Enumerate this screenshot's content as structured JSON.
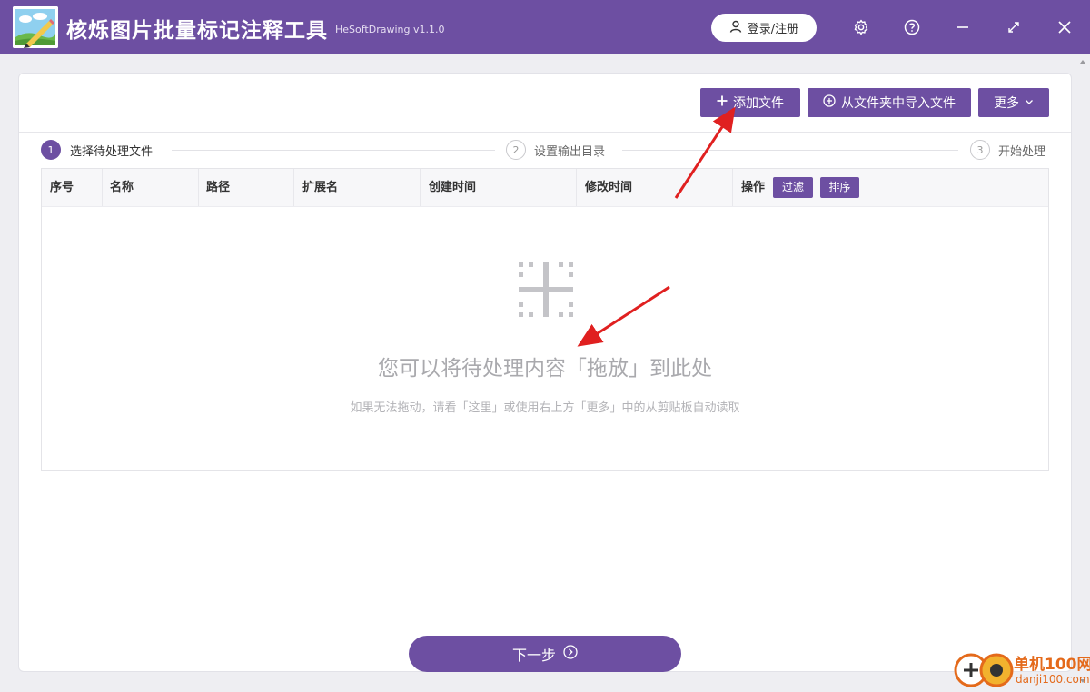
{
  "app": {
    "title": "核烁图片批量标记注释工具",
    "version": "HeSoftDrawing v1.1.0",
    "login_label": "登录/注册"
  },
  "titlebar_icons": [
    "settings-icon",
    "help-icon",
    "minimize-icon",
    "maximize-icon",
    "close-icon"
  ],
  "toolbar": {
    "add_file": "添加文件",
    "import_folder": "从文件夹中导入文件",
    "more": "更多"
  },
  "steps": [
    {
      "num": "1",
      "label": "选择待处理文件",
      "active": true
    },
    {
      "num": "2",
      "label": "设置输出目录",
      "active": false
    },
    {
      "num": "3",
      "label": "开始处理",
      "active": false
    }
  ],
  "table": {
    "columns": [
      "序号",
      "名称",
      "路径",
      "扩展名",
      "创建时间",
      "修改时间",
      "操作"
    ],
    "filter_label": "过滤",
    "sort_label": "排序",
    "rows": []
  },
  "dropzone": {
    "title": "您可以将待处理内容「拖放」到此处",
    "hint": "如果无法拖动，请看「这里」或使用右上方「更多」中的从剪贴板自动读取"
  },
  "next_label": "下一步",
  "watermark": {
    "line1": "单机100网",
    "line2": "danji100.com"
  },
  "colors": {
    "primary": "#6d4fa2",
    "annotation_arrow": "#e02020"
  }
}
